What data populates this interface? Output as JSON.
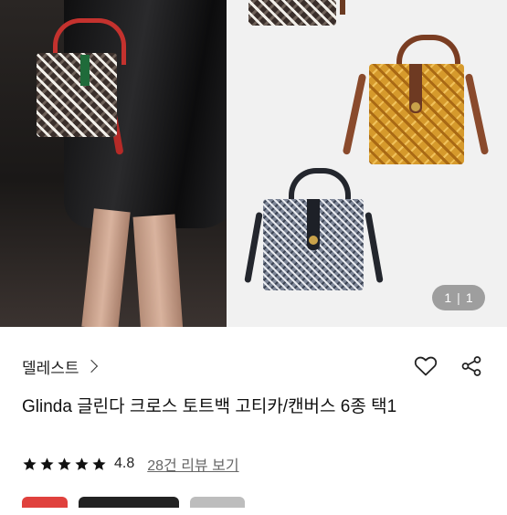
{
  "gallery": {
    "current_page": "1",
    "total_pages": "1",
    "photos": [
      {
        "icon": "model-with-bag-photo"
      },
      {
        "icon": "product-bags-photo"
      }
    ]
  },
  "store": {
    "name": "델레스트"
  },
  "product": {
    "title": "Glinda 글린다 크로스 토트백 고티카/캔버스 6종 택1"
  },
  "rating": {
    "value": "4.8",
    "stars": 5,
    "reviews_link": "28건 리뷰 보기"
  },
  "colors": {
    "star": "#111111",
    "price_red": "#e0413d"
  }
}
